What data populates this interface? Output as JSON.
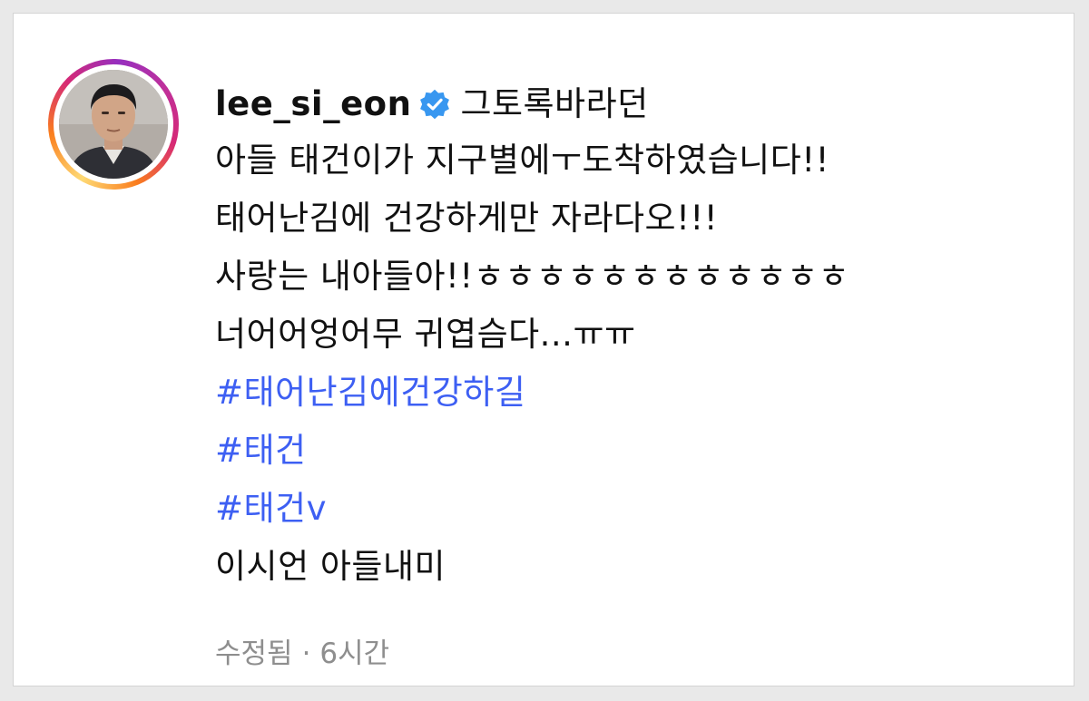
{
  "post": {
    "username": "lee_si_eon",
    "caption_lines": [
      "그토록바라던",
      "아들 태건이가 지구별에ㅜ도착하였습니다!!",
      "태어난김에 건강하게만 자라다오!!!",
      "사랑는 내아들아!!ㅎㅎㅎㅎㅎㅎㅎㅎㅎㅎㅎㅎ",
      "너어어엉어무 귀엽슴다...ㅠㅠ"
    ],
    "hashtags": [
      "#태어난김에건강하길",
      "#태건",
      "#태건v"
    ],
    "closing_line": "이시언 아들내미",
    "edited_label": "수정됨",
    "separator": "·",
    "time_ago": "6시간"
  },
  "colors": {
    "hashtag": "#3d5ff3",
    "verified_badge": "#3897f0",
    "meta_text": "#8e8e8e"
  },
  "icons": {
    "verified": "verified-badge-icon",
    "avatar": "profile-photo"
  }
}
